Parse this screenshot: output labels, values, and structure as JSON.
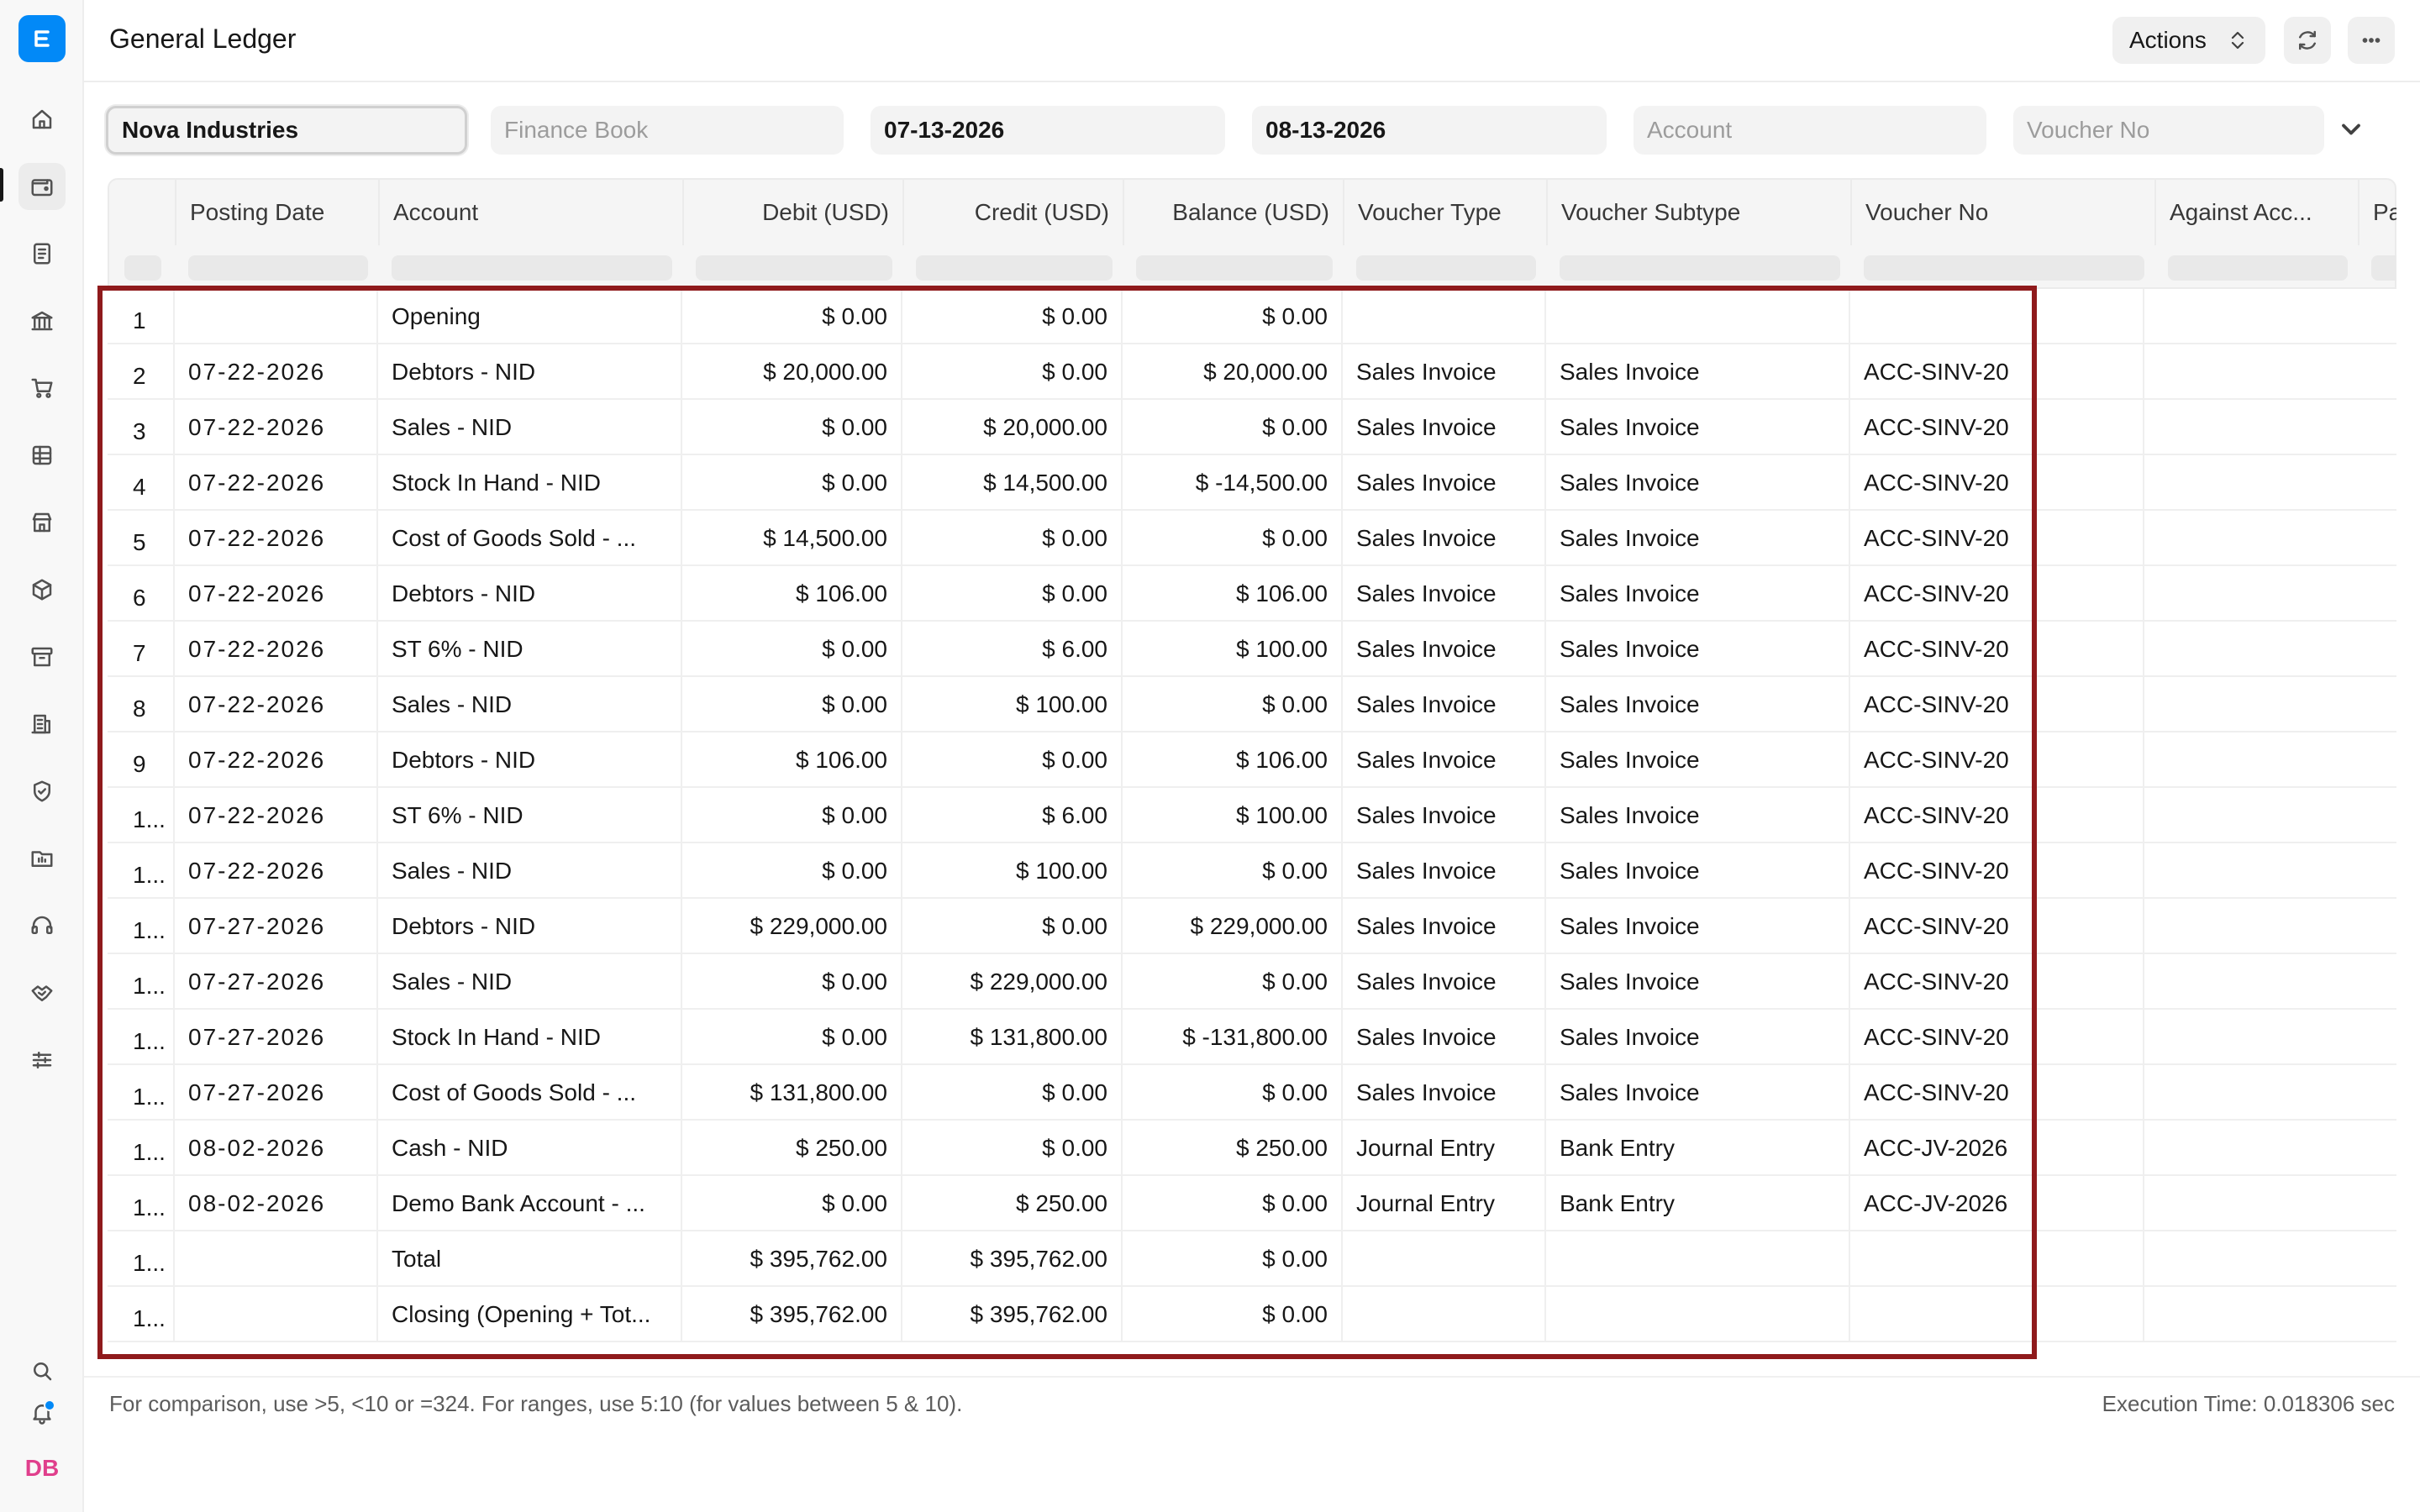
{
  "app": {
    "logo_letter": "E",
    "avatar_initials": "DB",
    "colors": {
      "brand": "#0289f7",
      "highlight": "#8f1a1c",
      "avatar": "#e03f8c"
    }
  },
  "header": {
    "title": "General Ledger",
    "actions_label": "Actions"
  },
  "sidebar": {
    "items": [
      {
        "icon": "home-icon"
      },
      {
        "icon": "wallet-icon",
        "active": true
      },
      {
        "icon": "document-icon"
      },
      {
        "icon": "bank-icon"
      },
      {
        "icon": "cart-icon"
      },
      {
        "icon": "table-icon"
      },
      {
        "icon": "store-icon"
      },
      {
        "icon": "box-icon"
      },
      {
        "icon": "archive-icon"
      },
      {
        "icon": "building-icon"
      },
      {
        "icon": "shield-icon"
      },
      {
        "icon": "folder-icon"
      },
      {
        "icon": "headset-icon"
      },
      {
        "icon": "handshake-icon"
      },
      {
        "icon": "sliders-icon"
      }
    ],
    "bottom": [
      {
        "icon": "search-icon"
      },
      {
        "icon": "bell-icon"
      }
    ]
  },
  "filters": {
    "company": "Nova Industries",
    "finance_book_placeholder": "Finance Book",
    "from_date": "07-13-2026",
    "to_date": "08-13-2026",
    "account_placeholder": "Account",
    "voucher_no_placeholder": "Voucher No"
  },
  "table": {
    "columns": [
      "",
      "Posting Date",
      "Account",
      "Debit (USD)",
      "Credit (USD)",
      "Balance (USD)",
      "Voucher Type",
      "Voucher Subtype",
      "Voucher No",
      "Against Acc...",
      "Pa"
    ],
    "rows": [
      {
        "idx": "1",
        "date": "",
        "account": "Opening",
        "debit": "$ 0.00",
        "credit": "$ 0.00",
        "balance": "$ 0.00",
        "vtype": "",
        "vsub": "",
        "vno": ""
      },
      {
        "idx": "2",
        "date": "07-22-2026",
        "account": "Debtors - NID",
        "debit": "$ 20,000.00",
        "credit": "$ 0.00",
        "balance": "$ 20,000.00",
        "vtype": "Sales Invoice",
        "vsub": "Sales Invoice",
        "vno": "ACC-SINV-20"
      },
      {
        "idx": "3",
        "date": "07-22-2026",
        "account": "Sales - NID",
        "debit": "$ 0.00",
        "credit": "$ 20,000.00",
        "balance": "$ 0.00",
        "vtype": "Sales Invoice",
        "vsub": "Sales Invoice",
        "vno": "ACC-SINV-20"
      },
      {
        "idx": "4",
        "date": "07-22-2026",
        "account": "Stock In Hand - NID",
        "debit": "$ 0.00",
        "credit": "$ 14,500.00",
        "balance": "$ -14,500.00",
        "vtype": "Sales Invoice",
        "vsub": "Sales Invoice",
        "vno": "ACC-SINV-20"
      },
      {
        "idx": "5",
        "date": "07-22-2026",
        "account": "Cost of Goods Sold - ...",
        "debit": "$ 14,500.00",
        "credit": "$ 0.00",
        "balance": "$ 0.00",
        "vtype": "Sales Invoice",
        "vsub": "Sales Invoice",
        "vno": "ACC-SINV-20"
      },
      {
        "idx": "6",
        "date": "07-22-2026",
        "account": "Debtors - NID",
        "debit": "$ 106.00",
        "credit": "$ 0.00",
        "balance": "$ 106.00",
        "vtype": "Sales Invoice",
        "vsub": "Sales Invoice",
        "vno": "ACC-SINV-20"
      },
      {
        "idx": "7",
        "date": "07-22-2026",
        "account": "ST 6% - NID",
        "debit": "$ 0.00",
        "credit": "$ 6.00",
        "balance": "$ 100.00",
        "vtype": "Sales Invoice",
        "vsub": "Sales Invoice",
        "vno": "ACC-SINV-20"
      },
      {
        "idx": "8",
        "date": "07-22-2026",
        "account": "Sales - NID",
        "debit": "$ 0.00",
        "credit": "$ 100.00",
        "balance": "$ 0.00",
        "vtype": "Sales Invoice",
        "vsub": "Sales Invoice",
        "vno": "ACC-SINV-20"
      },
      {
        "idx": "9",
        "date": "07-22-2026",
        "account": "Debtors - NID",
        "debit": "$ 106.00",
        "credit": "$ 0.00",
        "balance": "$ 106.00",
        "vtype": "Sales Invoice",
        "vsub": "Sales Invoice",
        "vno": "ACC-SINV-20"
      },
      {
        "idx": "1...",
        "date": "07-22-2026",
        "account": "ST 6% - NID",
        "debit": "$ 0.00",
        "credit": "$ 6.00",
        "balance": "$ 100.00",
        "vtype": "Sales Invoice",
        "vsub": "Sales Invoice",
        "vno": "ACC-SINV-20"
      },
      {
        "idx": "1...",
        "date": "07-22-2026",
        "account": "Sales - NID",
        "debit": "$ 0.00",
        "credit": "$ 100.00",
        "balance": "$ 0.00",
        "vtype": "Sales Invoice",
        "vsub": "Sales Invoice",
        "vno": "ACC-SINV-20"
      },
      {
        "idx": "1...",
        "date": "07-27-2026",
        "account": "Debtors - NID",
        "debit": "$ 229,000.00",
        "credit": "$ 0.00",
        "balance": "$ 229,000.00",
        "vtype": "Sales Invoice",
        "vsub": "Sales Invoice",
        "vno": "ACC-SINV-20"
      },
      {
        "idx": "1...",
        "date": "07-27-2026",
        "account": "Sales - NID",
        "debit": "$ 0.00",
        "credit": "$ 229,000.00",
        "balance": "$ 0.00",
        "vtype": "Sales Invoice",
        "vsub": "Sales Invoice",
        "vno": "ACC-SINV-20"
      },
      {
        "idx": "1...",
        "date": "07-27-2026",
        "account": "Stock In Hand - NID",
        "debit": "$ 0.00",
        "credit": "$ 131,800.00",
        "balance": "$ -131,800.00",
        "vtype": "Sales Invoice",
        "vsub": "Sales Invoice",
        "vno": "ACC-SINV-20"
      },
      {
        "idx": "1...",
        "date": "07-27-2026",
        "account": "Cost of Goods Sold - ...",
        "debit": "$ 131,800.00",
        "credit": "$ 0.00",
        "balance": "$ 0.00",
        "vtype": "Sales Invoice",
        "vsub": "Sales Invoice",
        "vno": "ACC-SINV-20"
      },
      {
        "idx": "1...",
        "date": "08-02-2026",
        "account": "Cash - NID",
        "debit": "$ 250.00",
        "credit": "$ 0.00",
        "balance": "$ 250.00",
        "vtype": "Journal Entry",
        "vsub": "Bank Entry",
        "vno": "ACC-JV-2026"
      },
      {
        "idx": "1...",
        "date": "08-02-2026",
        "account": "Demo Bank Account - ...",
        "debit": "$ 0.00",
        "credit": "$ 250.00",
        "balance": "$ 0.00",
        "vtype": "Journal Entry",
        "vsub": "Bank Entry",
        "vno": "ACC-JV-2026"
      },
      {
        "idx": "1...",
        "date": "",
        "account": "Total",
        "debit": "$ 395,762.00",
        "credit": "$ 395,762.00",
        "balance": "$ 0.00",
        "vtype": "",
        "vsub": "",
        "vno": ""
      },
      {
        "idx": "1...",
        "date": "",
        "account": "Closing (Opening + Tot...",
        "debit": "$ 395,762.00",
        "credit": "$ 395,762.00",
        "balance": "$ 0.00",
        "vtype": "",
        "vsub": "",
        "vno": ""
      }
    ]
  },
  "footer": {
    "hint": "For comparison, use >5, <10 or =324. For ranges, use 5:10 (for values between 5 & 10).",
    "execution_time": "Execution Time: 0.018306 sec"
  }
}
